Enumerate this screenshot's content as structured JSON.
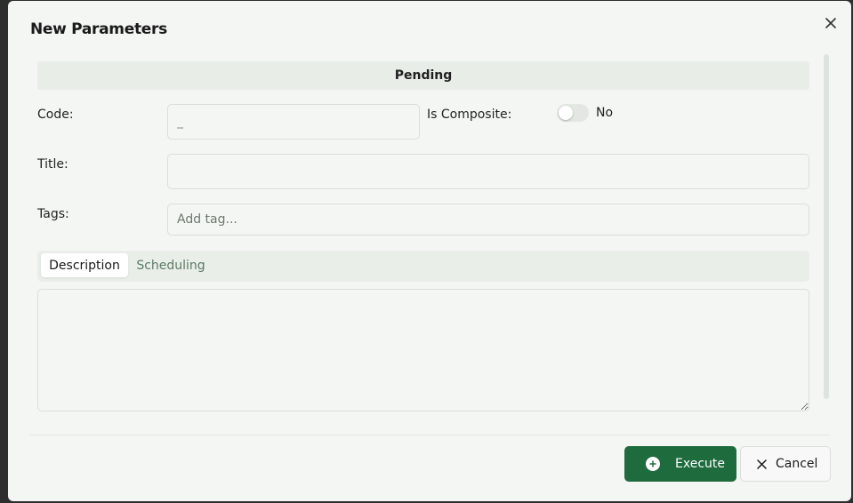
{
  "dialog": {
    "title": "New Parameters",
    "status": "Pending"
  },
  "form": {
    "code": {
      "label": "Code:",
      "placeholder": "_",
      "value": ""
    },
    "is_composite": {
      "label": "Is Composite:",
      "state_text": "No",
      "checked": false
    },
    "title": {
      "label": "Title:",
      "value": ""
    },
    "tags": {
      "label": "Tags:",
      "placeholder": "Add tag..."
    }
  },
  "tabs": [
    {
      "label": "Description",
      "active": true
    },
    {
      "label": "Scheduling",
      "active": false
    }
  ],
  "footer": {
    "execute_label": "Execute",
    "cancel_label": "Cancel"
  },
  "colors": {
    "primary": "#1e6b3e",
    "background": "#f4f6f4",
    "inactive_tab_text": "#5d7a66"
  },
  "icons": {
    "close": "close-icon",
    "execute": "plus-circle-icon",
    "cancel": "x-icon"
  }
}
